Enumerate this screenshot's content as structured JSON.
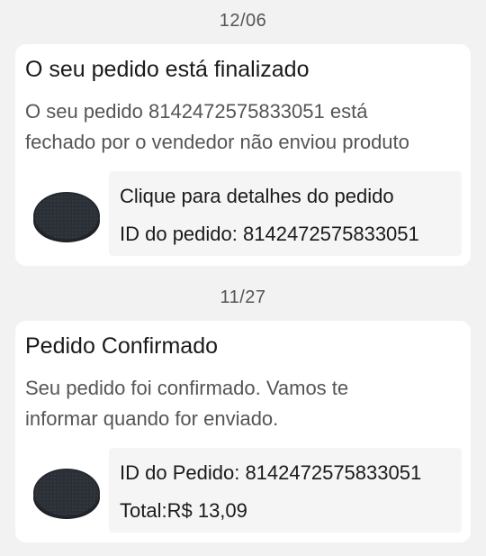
{
  "messages": [
    {
      "date": "12/06",
      "title": "O seu pedido está finalizado",
      "body_line1": "O seu pedido 8142472575833051 está",
      "body_line2": "fechado por o vendedor não enviou produto",
      "link_text": "Clique para detalhes do pedido",
      "order_id_label": "ID do pedido:",
      "order_id_value": "8142472575833051"
    },
    {
      "date": "11/27",
      "title": "Pedido Confirmado",
      "body_line1": "Seu pedido foi confirmado. Vamos te",
      "body_line2": "informar quando for enviado.",
      "order_id_label": "ID do Pedido:",
      "order_id_value": "8142472575833051",
      "total_label": "Total:",
      "total_value": "R$ 13,09"
    }
  ],
  "colors": {
    "background": "#f2f2f2",
    "card": "#ffffff",
    "order_box": "#f5f5f5",
    "product": "#2b2f36"
  },
  "icons": {
    "product_image": "round-black-pad-product-image"
  }
}
